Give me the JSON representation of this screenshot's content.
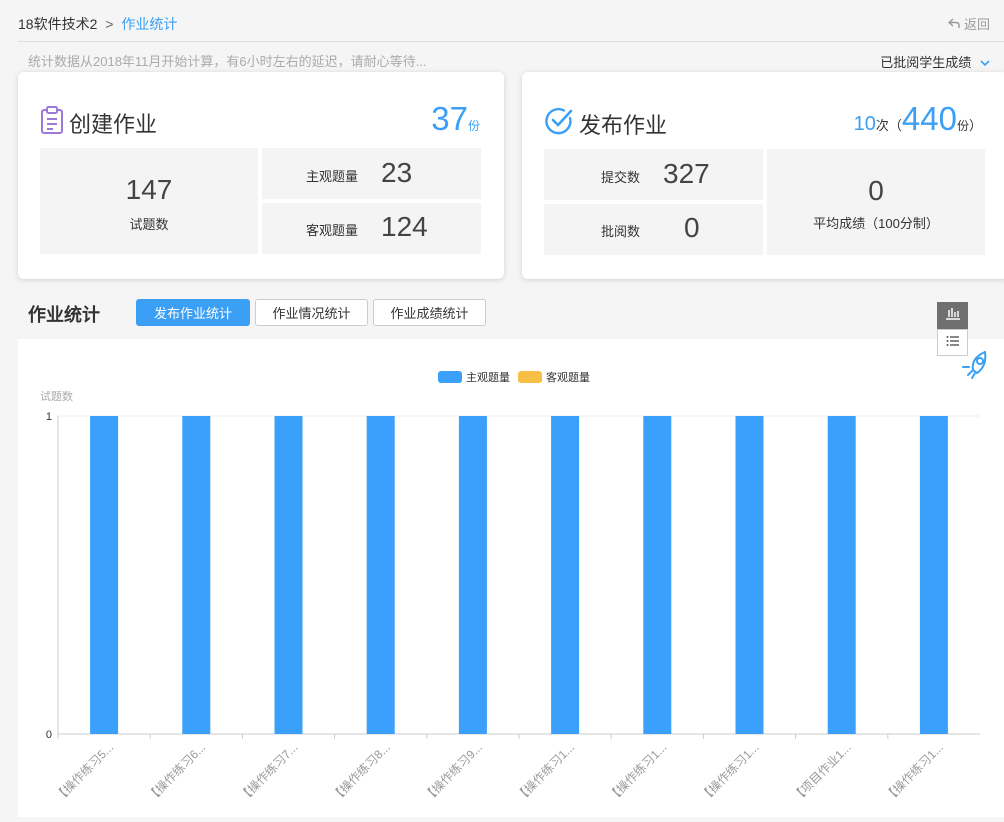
{
  "breadcrumb": {
    "course": "18软件技术2",
    "separator": ">",
    "current": "作业统计"
  },
  "back_label": "返回",
  "notice": "统计数据从2018年11月开始计算，有6小时左右的延迟，请耐心等待...",
  "graded_dropdown": "已批阅学生成绩",
  "create_card": {
    "title": "创建作业",
    "count": "37",
    "count_unit": "份",
    "total_value": "147",
    "total_label": "试题数",
    "subjective_label": "主观题量",
    "subjective_value": "23",
    "objective_label": "客观题量",
    "objective_value": "124"
  },
  "publish_card": {
    "title": "发布作业",
    "times": "10",
    "times_unit": "次",
    "paren_open": "（",
    "count": "440",
    "count_unit": "份",
    "paren_close": "）",
    "submit_label": "提交数",
    "submit_value": "327",
    "review_label": "批阅数",
    "review_value": "0",
    "avg_value": "0",
    "avg_label": "平均成绩（100分制）"
  },
  "section_title": "作业统计",
  "tabs": [
    "发布作业统计",
    "作业情况统计",
    "作业成绩统计"
  ],
  "colors": {
    "accent": "#3a9ff5",
    "subjective": "#3aa0fb",
    "objective": "#f7bf45"
  },
  "chart_data": {
    "type": "bar",
    "ylabel": "试题数",
    "ylim": [
      0,
      1
    ],
    "yticks": [
      "0",
      "1"
    ],
    "categories": [
      "【操作练习5...",
      "【操作练习6...",
      "【操作练习7...",
      "【操作练习8...",
      "【操作练习9...",
      "【操作练习1...",
      "【操作练习1...",
      "【操作练习1...",
      "【项目作业1...",
      "【操作练习1..."
    ],
    "series": [
      {
        "name": "主观题量",
        "color": "#3aa0fb",
        "values": [
          1,
          1,
          1,
          1,
          1,
          1,
          1,
          1,
          1,
          1
        ]
      },
      {
        "name": "客观题量",
        "color": "#f7bf45",
        "values": [
          0,
          0,
          0,
          0,
          0,
          0,
          0,
          0,
          0,
          0
        ]
      }
    ],
    "legend": "top-center",
    "grid": true
  }
}
